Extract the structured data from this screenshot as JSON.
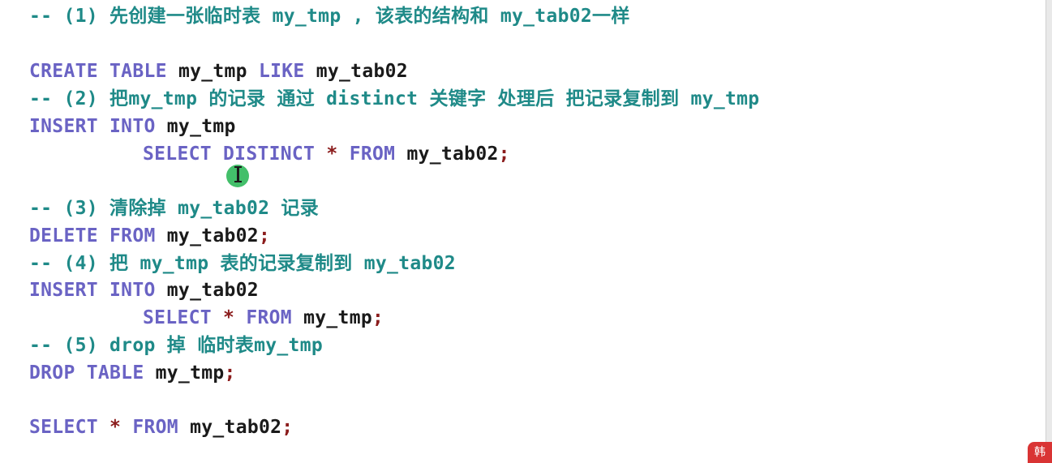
{
  "code": {
    "l1": {
      "comment": "-- (1) 先创建一张临时表 my_tmp , 该表的结构和 my_tab02一样"
    },
    "l3": {
      "kw1": "CREATE TABLE",
      "id1": "my_tmp",
      "kw2": "LIKE",
      "id2": "my_tab02"
    },
    "l4": {
      "comment": "-- (2) 把my_tmp 的记录 通过 distinct 关键字 处理后 把记录复制到 my_tmp"
    },
    "l5": {
      "kw1": "INSERT INTO",
      "id1": "my_tmp"
    },
    "l6": {
      "kw1": "SELECT DISTINCT",
      "op1": "*",
      "kw2": "FROM",
      "id1": "my_tab02",
      "semi": ";"
    },
    "l8": {
      "comment": "-- (3) 清除掉 my_tab02 记录"
    },
    "l9": {
      "kw1": "DELETE FROM",
      "id1": "my_tab02",
      "semi": ";"
    },
    "l10": {
      "comment": "-- (4) 把 my_tmp 表的记录复制到 my_tab02"
    },
    "l11": {
      "kw1": "INSERT INTO",
      "id1": "my_tab02"
    },
    "l12": {
      "kw1": "SELECT",
      "op1": "*",
      "kw2": "FROM",
      "id1": "my_tmp",
      "semi": ";"
    },
    "l13": {
      "comment": "-- (5) drop 掉 临时表my_tmp"
    },
    "l14": {
      "kw1": "DROP TABLE",
      "id1": "my_tmp",
      "semi": ";"
    },
    "l16": {
      "kw1": "SELECT",
      "op1": "*",
      "kw2": "FROM",
      "id1": "my_tab02",
      "semi": ";"
    }
  },
  "badge": {
    "text": "韩"
  },
  "colors": {
    "comment": "#1f8a88",
    "keyword": "#6a63c4",
    "identifier": "#1a1a1a",
    "operator": "#8b1c1c",
    "cursor_highlight": "#22b450",
    "badge": "#d93434"
  },
  "icons": {
    "cursor": "i-beam-cursor-icon",
    "highlight": "click-highlight-icon"
  }
}
